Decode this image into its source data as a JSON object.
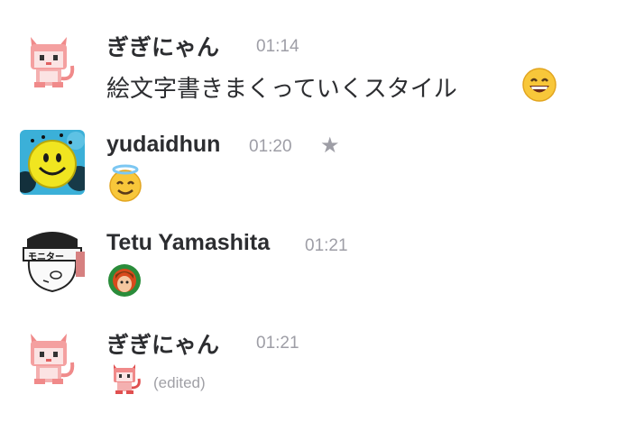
{
  "messages": [
    {
      "author": "ぎぎにゃん",
      "time": "01:14",
      "text": "絵文字書きまくっていくスタイル",
      "emoji": "smile-emoji",
      "avatar": "pink-cat-avatar"
    },
    {
      "author": "yudaidhun",
      "time": "01:20",
      "text": "",
      "emoji": "innocent-emoji",
      "avatar": "yellow-smiley-ball-avatar",
      "starred": true
    },
    {
      "author": "Tetu Yamashita",
      "time": "01:21",
      "text": "",
      "emoji": "custom-face-emoji",
      "avatar": "manga-monitor-avatar",
      "avatar_text": "モニター"
    },
    {
      "author": "ぎぎにゃん",
      "time": "01:21",
      "text": "",
      "emoji": "pink-cat-emoji",
      "avatar": "pink-cat-avatar",
      "edited": "(edited)"
    }
  ],
  "colors": {
    "name": "#2c2d30",
    "timestamp": "#9e9ea6",
    "star": "#9e9ea6"
  }
}
